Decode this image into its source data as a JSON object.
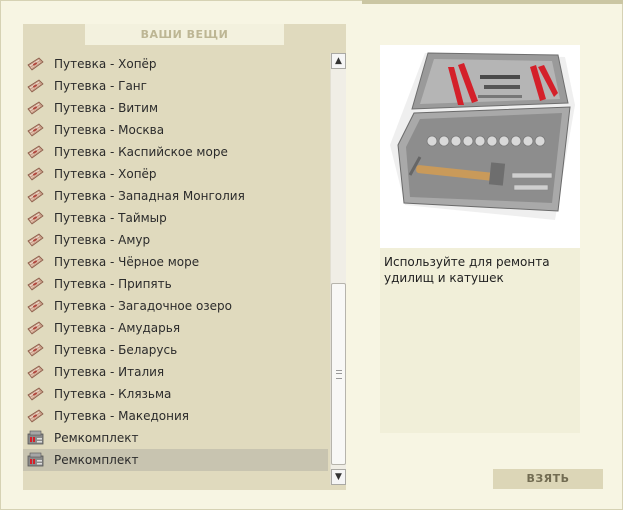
{
  "panel": {
    "title": "ВАШИ ВЕЩИ"
  },
  "items": [
    {
      "label": "Путевка - Хопёр",
      "icon": "voucher-icon"
    },
    {
      "label": "Путевка - Ганг",
      "icon": "voucher-icon"
    },
    {
      "label": "Путевка - Витим",
      "icon": "voucher-icon"
    },
    {
      "label": "Путевка - Москва",
      "icon": "voucher-icon"
    },
    {
      "label": "Путевка - Каспийское море",
      "icon": "voucher-icon"
    },
    {
      "label": "Путевка - Хопёр",
      "icon": "voucher-icon"
    },
    {
      "label": "Путевка - Западная Монголия",
      "icon": "voucher-icon"
    },
    {
      "label": "Путевка - Таймыр",
      "icon": "voucher-icon"
    },
    {
      "label": "Путевка - Амур",
      "icon": "voucher-icon"
    },
    {
      "label": "Путевка - Чёрное море",
      "icon": "voucher-icon"
    },
    {
      "label": "Путевка - Припять",
      "icon": "voucher-icon"
    },
    {
      "label": "Путевка - Загадочное озеро",
      "icon": "voucher-icon"
    },
    {
      "label": "Путевка - Амударья",
      "icon": "voucher-icon"
    },
    {
      "label": "Путевка - Беларусь",
      "icon": "voucher-icon"
    },
    {
      "label": "Путевка - Италия",
      "icon": "voucher-icon"
    },
    {
      "label": "Путевка - Клязьма",
      "icon": "voucher-icon"
    },
    {
      "label": "Путевка - Македония",
      "icon": "voucher-icon"
    },
    {
      "label": "Ремкомплект",
      "icon": "repair-kit-icon"
    },
    {
      "label": "Ремкомплект",
      "icon": "repair-kit-icon",
      "selected": true
    }
  ],
  "detail": {
    "image_icon": "tool-case-image",
    "description": "Используйте для ремонта удилищ и катушек"
  },
  "actions": {
    "take_label": "ВЗЯТЬ"
  },
  "colors": {
    "panel_bg": "#e0dabe",
    "selected_bg": "#c8c4b0",
    "button_bg": "#dcd6b7",
    "button_text": "#726c52",
    "tool_accent": "#d4202a"
  }
}
